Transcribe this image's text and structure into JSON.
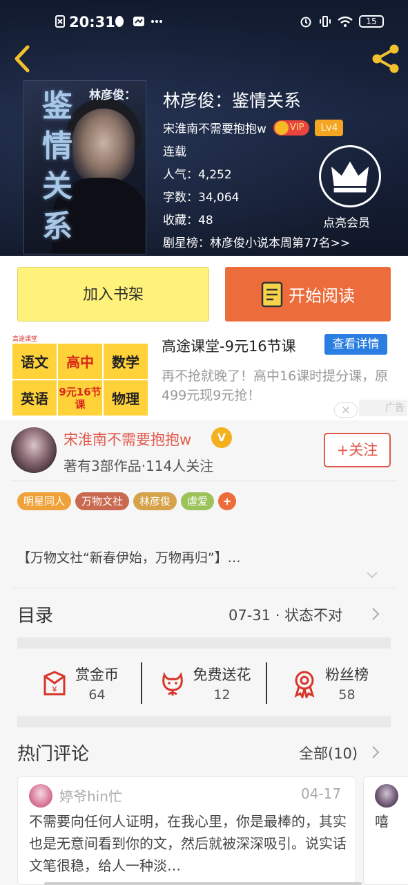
{
  "status_bar": {
    "time": "20:31",
    "battery": "15"
  },
  "book": {
    "title": "林彦俊：鉴情关系",
    "author": "宋淮南不需要抱抱w",
    "vip_label": "VIP",
    "level": "Lv4",
    "state": "连载",
    "popularity": "人气：4,252",
    "words": "字数：34,064",
    "favorites": "收藏：48",
    "ranking": "剧星榜：林彦俊小说本周第77名>>",
    "member_label": "点亮会员"
  },
  "cover": {
    "title_chars": "鉴情关系",
    "author_text": "林彦俊："
  },
  "actions": {
    "shelf_label": "加入书架",
    "read_label": "开始阅读"
  },
  "ad": {
    "brand": "高途课堂",
    "cells": [
      "语文",
      "高中",
      "数学",
      "英语",
      "9元16节课",
      "物理"
    ],
    "title": "高途课堂-9元16节课",
    "button": "查看详情",
    "desc": "再不抢就晚了！高中16课时提分课，原499元现9元抢！",
    "tag": "广告"
  },
  "author_profile": {
    "name": "宋淮南不需要抱抱w",
    "badge": "V",
    "sub": "著有3部作品·114人关注",
    "follow_label": "+关注"
  },
  "tags": [
    {
      "label": "明星同人",
      "color": "#f0a23a"
    },
    {
      "label": "万物文社",
      "color": "#c9694f"
    },
    {
      "label": "林彦俊",
      "color": "#d6a24a"
    },
    {
      "label": "虐爱",
      "color": "#9cc25a"
    },
    {
      "label": "+",
      "color": "#ec6c3c"
    }
  ],
  "blurb": "【万物文社“新春伊始，万物再归”】…",
  "catalog": {
    "label": "目录",
    "info": "07-31 · 状态不对"
  },
  "stats": [
    {
      "label": "赏金币",
      "value": "64",
      "icon": "red-envelope-icon"
    },
    {
      "label": "免费送花",
      "value": "12",
      "icon": "flower-icon"
    },
    {
      "label": "粉丝榜",
      "value": "58",
      "icon": "medal-icon"
    }
  ],
  "comments": {
    "label": "热门评论",
    "all": "全部(10)",
    "items": [
      {
        "user": "婷爷hin忙",
        "date": "04-17",
        "text": "不需要向任何人证明，在我心里，你是最棒的，其实也是无意间看到你的文，然后就被深深吸引。说实话文笔很稳，给人一种淡…"
      },
      {
        "text": "嘻"
      }
    ]
  }
}
